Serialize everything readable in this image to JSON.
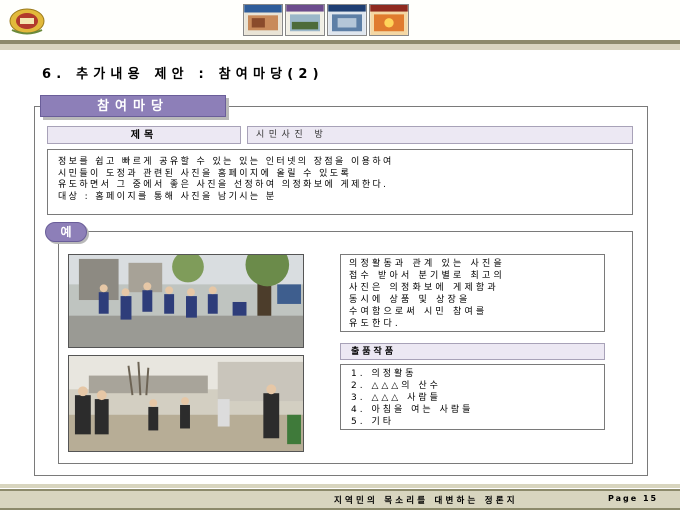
{
  "header": {
    "logo_icon": "council-emblem-icon",
    "thumbnail_count": 4
  },
  "section_title": "6. 추가내용 제안 : 참여마당(2)",
  "frame": {
    "tab_label": "참여마당",
    "field_label": "제목",
    "field_value": "시민사진 방",
    "description": [
      "정보를 쉽고 빠르게 공유할 수 있는 있는 인터넷의 장점을 이용하여",
      "시민들이 도정과 관련된 사진을 홈페이지에 올릴 수 있도록",
      "유도하면서 그 중에서 좋은 사진을 선정하여 의정화보에 게제한다.",
      "대상 : 홈페이지를 통해 사진을 남기시는 분"
    ],
    "example_badge": "예",
    "explanation": [
      "의정활동과 관계 있는 사진을",
      "접수 받아서 분기별로 최고의",
      "사진은 의정화보에 게제함과",
      "동시에 상품 및 상장을",
      "수여함으로써 시민 참여를",
      "유도한다."
    ],
    "entries_label": "출품작품",
    "entries": [
      "1. 의정활동",
      "2. △△△의 산수",
      "3. △△△ 사람들",
      "4. 아침을 여는 사람들",
      "5. 기타"
    ]
  },
  "footer": {
    "slogan": "지역민의 목소리를 대변하는 정론지",
    "page": "Page 15"
  }
}
